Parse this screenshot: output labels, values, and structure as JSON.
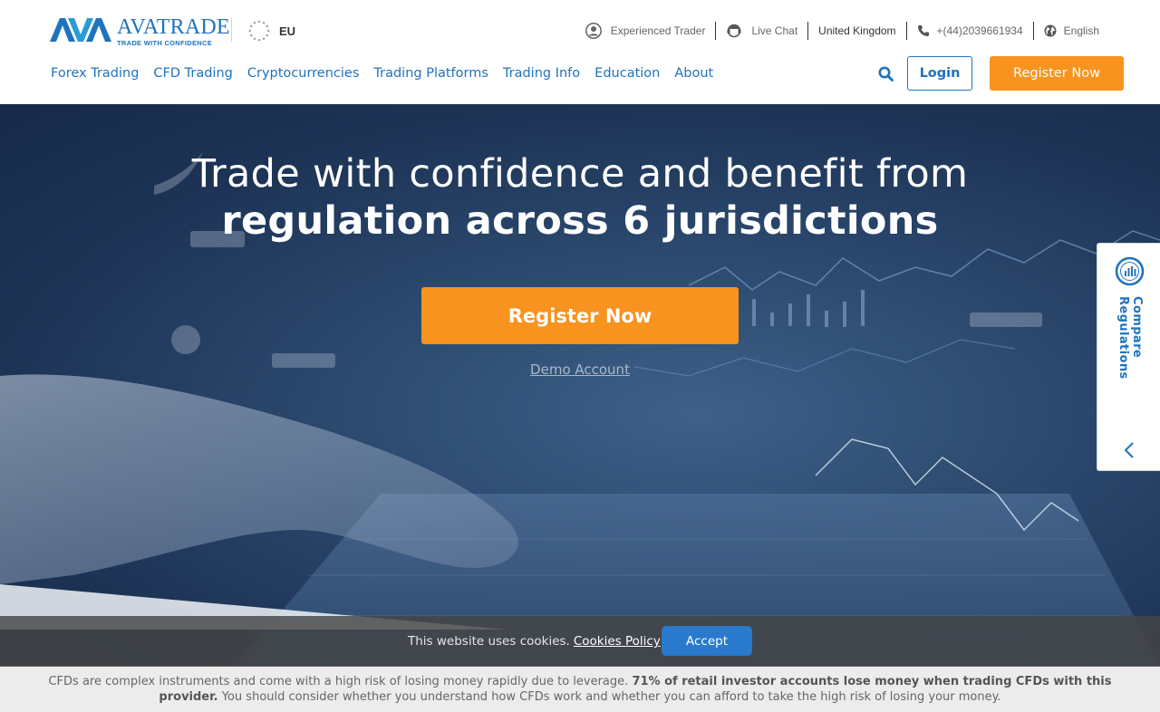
{
  "brand": {
    "name": "AVATRADE",
    "tagline": "TRADE WITH CONFIDENCE",
    "region": "EU"
  },
  "topbar": {
    "experienced": "Experienced Trader",
    "live_chat": "Live Chat",
    "country": "United Kingdom",
    "phone": "+(44)2039661934",
    "language": "English"
  },
  "nav": {
    "items": [
      "Forex Trading",
      "CFD Trading",
      "Cryptocurrencies",
      "Trading Platforms",
      "Trading Info",
      "Education",
      "About"
    ],
    "login": "Login",
    "register": "Register Now"
  },
  "hero": {
    "title_line1": "Trade with confidence and benefit from",
    "title_line2": "regulation across 6 jurisdictions",
    "register": "Register Now",
    "demo": "Demo Account"
  },
  "compare": {
    "label": "Compare Regulations"
  },
  "cookie": {
    "text": "This website uses cookies.",
    "link": "Cookies Policy",
    "accept": "Accept"
  },
  "risk": {
    "part1": "CFDs are complex instruments and come with a high risk of losing money rapidly due to leverage.",
    "bold": "71% of retail investor accounts lose money when trading CFDs with this provider.",
    "part2": "You should consider whether you understand how CFDs work and whether you can afford to take the high risk of losing your money."
  },
  "colors": {
    "brand_blue": "#1e73be",
    "orange": "#f7931e",
    "accept_blue": "#2979cc"
  }
}
